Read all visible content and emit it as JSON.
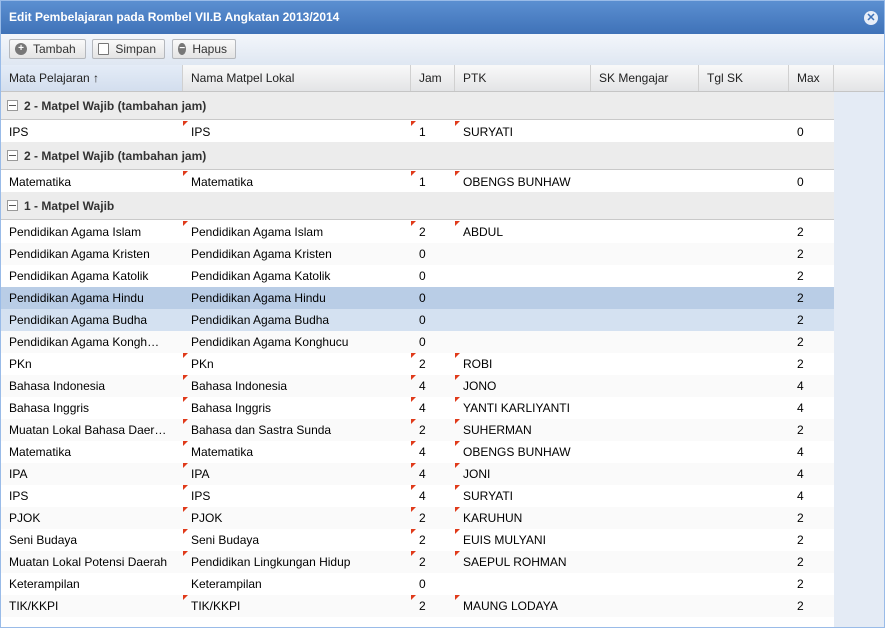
{
  "window": {
    "title": "Edit Pembelajaran pada Rombel VII.B Angkatan 2013/2014",
    "close_glyph": "✕"
  },
  "toolbar": {
    "add_label": "Tambah",
    "save_label": "Simpan",
    "delete_label": "Hapus"
  },
  "columns": [
    "Mata Pelajaran ↑",
    "Nama Matpel Lokal",
    "Jam",
    "PTK",
    "SK Mengajar",
    "Tgl SK",
    "Max"
  ],
  "groups": [
    {
      "title": "2 - Matpel Wajib (tambahan jam)",
      "rows": [
        {
          "mapel": "IPS",
          "lokal": "IPS",
          "jam": "1",
          "ptk": "SURYATI",
          "sk": "",
          "tgl": "",
          "max": "0"
        }
      ]
    },
    {
      "title": "2 - Matpel Wajib (tambahan jam)",
      "rows": [
        {
          "mapel": "Matematika",
          "lokal": "Matematika",
          "jam": "1",
          "ptk": "OBENGS BUNHAW",
          "sk": "",
          "tgl": "",
          "max": "0"
        }
      ]
    },
    {
      "title": "1 - Matpel Wajib",
      "rows": [
        {
          "mapel": "Pendidikan Agama Islam",
          "lokal": "Pendidikan Agama Islam",
          "jam": "2",
          "ptk": "ABDUL",
          "sk": "",
          "tgl": "",
          "max": "2"
        },
        {
          "mapel": "Pendidikan Agama Kristen",
          "lokal": "Pendidikan Agama Kristen",
          "jam": "0",
          "ptk": "",
          "sk": "",
          "tgl": "",
          "max": "2"
        },
        {
          "mapel": "Pendidikan Agama Katolik",
          "lokal": "Pendidikan Agama Katolik",
          "jam": "0",
          "ptk": "",
          "sk": "",
          "tgl": "",
          "max": "2"
        },
        {
          "mapel": "Pendidikan Agama Hindu",
          "lokal": "Pendidikan Agama Hindu",
          "jam": "0",
          "ptk": "",
          "sk": "",
          "tgl": "",
          "max": "2"
        },
        {
          "mapel": "Pendidikan Agama Budha",
          "lokal": "Pendidikan Agama Budha",
          "jam": "0",
          "ptk": "",
          "sk": "",
          "tgl": "",
          "max": "2"
        },
        {
          "mapel": "Pendidikan Agama Kongh…",
          "lokal": "Pendidikan Agama Konghucu",
          "jam": "0",
          "ptk": "",
          "sk": "",
          "tgl": "",
          "max": "2"
        },
        {
          "mapel": "PKn",
          "lokal": "PKn",
          "jam": "2",
          "ptk": "ROBI",
          "sk": "",
          "tgl": "",
          "max": "2"
        },
        {
          "mapel": "Bahasa Indonesia",
          "lokal": "Bahasa Indonesia",
          "jam": "4",
          "ptk": "JONO",
          "sk": "",
          "tgl": "",
          "max": "4"
        },
        {
          "mapel": "Bahasa Inggris",
          "lokal": "Bahasa Inggris",
          "jam": "4",
          "ptk": "YANTI KARLIYANTI",
          "sk": "",
          "tgl": "",
          "max": "4"
        },
        {
          "mapel": "Muatan Lokal Bahasa Daer…",
          "lokal": "Bahasa dan Sastra Sunda",
          "jam": "2",
          "ptk": "SUHERMAN",
          "sk": "",
          "tgl": "",
          "max": "2"
        },
        {
          "mapel": "Matematika",
          "lokal": "Matematika",
          "jam": "4",
          "ptk": "OBENGS BUNHAW",
          "sk": "",
          "tgl": "",
          "max": "4"
        },
        {
          "mapel": "IPA",
          "lokal": "IPA",
          "jam": "4",
          "ptk": "JONI",
          "sk": "",
          "tgl": "",
          "max": "4"
        },
        {
          "mapel": "IPS",
          "lokal": "IPS",
          "jam": "4",
          "ptk": "SURYATI",
          "sk": "",
          "tgl": "",
          "max": "4"
        },
        {
          "mapel": "PJOK",
          "lokal": "PJOK",
          "jam": "2",
          "ptk": "KARUHUN",
          "sk": "",
          "tgl": "",
          "max": "2"
        },
        {
          "mapel": "Seni Budaya",
          "lokal": "Seni Budaya",
          "jam": "2",
          "ptk": "EUIS MULYANI",
          "sk": "",
          "tgl": "",
          "max": "2"
        },
        {
          "mapel": "Muatan Lokal Potensi Daerah",
          "lokal": "Pendidikan Lingkungan Hidup",
          "jam": "2",
          "ptk": "SAEPUL ROHMAN",
          "sk": "",
          "tgl": "",
          "max": "2"
        },
        {
          "mapel": "Keterampilan",
          "lokal": "Keterampilan",
          "jam": "0",
          "ptk": "",
          "sk": "",
          "tgl": "",
          "max": "2"
        },
        {
          "mapel": "TIK/KKPI",
          "lokal": "TIK/KKPI",
          "jam": "2",
          "ptk": "MAUNG LODAYA",
          "sk": "",
          "tgl": "",
          "max": "2"
        }
      ]
    }
  ],
  "colors": {
    "title_bar": "#4a7fc4",
    "selected_row": "#b9cde6",
    "hover_row": "#d4e1f1",
    "dirty_marker": "#e03a1a"
  },
  "icons": {
    "add": "plus-circle-icon",
    "save": "floppy-disk-icon",
    "delete": "minus-circle-icon",
    "close": "close-icon",
    "sort": "sort-asc-icon"
  }
}
